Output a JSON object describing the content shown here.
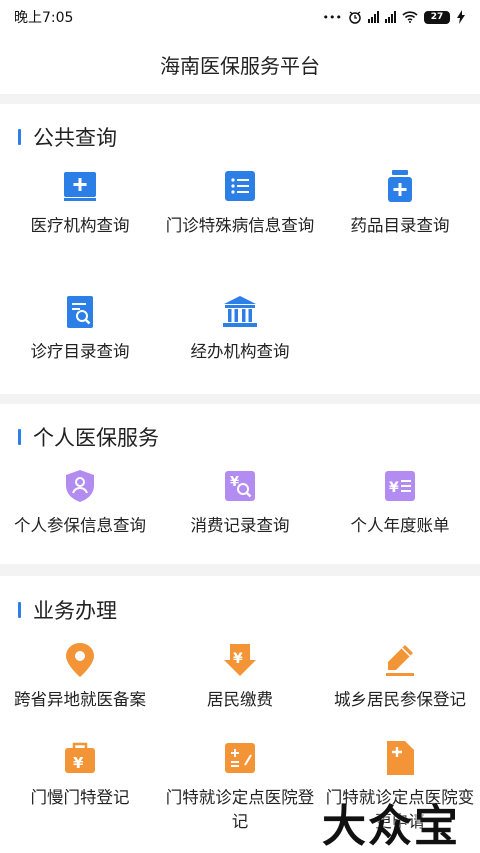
{
  "status": {
    "time": "晚上7:05",
    "dots": "•••",
    "battery": "27"
  },
  "header": {
    "title": "海南医保服务平台"
  },
  "sections": [
    {
      "title": "公共查询",
      "items": [
        {
          "label": "医疗机构查询",
          "icon": "hospital-plus-icon"
        },
        {
          "label": "门诊特殊病信息查询",
          "icon": "list-icon"
        },
        {
          "label": "药品目录查询",
          "icon": "medicine-bottle-icon"
        },
        {
          "label": "诊疗目录查询",
          "icon": "document-search-icon"
        },
        {
          "label": "经办机构查询",
          "icon": "institution-building-icon"
        }
      ]
    },
    {
      "title": "个人医保服务",
      "items": [
        {
          "label": "个人参保信息查询",
          "icon": "shield-person-icon"
        },
        {
          "label": "消费记录查询",
          "icon": "yen-search-icon"
        },
        {
          "label": "个人年度账单",
          "icon": "yen-bill-icon"
        }
      ]
    },
    {
      "title": "业务办理",
      "items": [
        {
          "label": "跨省异地就医备案",
          "icon": "location-pin-icon"
        },
        {
          "label": "居民缴费",
          "icon": "yen-down-arrow-icon"
        },
        {
          "label": "城乡居民参保登记",
          "icon": "edit-pencil-icon"
        },
        {
          "label": "门慢门特登记",
          "icon": "briefcase-yen-icon"
        },
        {
          "label": "门特就诊定点医院登记",
          "icon": "calculator-icon"
        },
        {
          "label": "门特就诊定点医院变更申请",
          "icon": "document-plus-icon"
        }
      ]
    }
  ],
  "watermark": "大众宝",
  "colors": {
    "blue": "#2d7fe8",
    "purple": "#b28cf0",
    "orange": "#f39436"
  }
}
